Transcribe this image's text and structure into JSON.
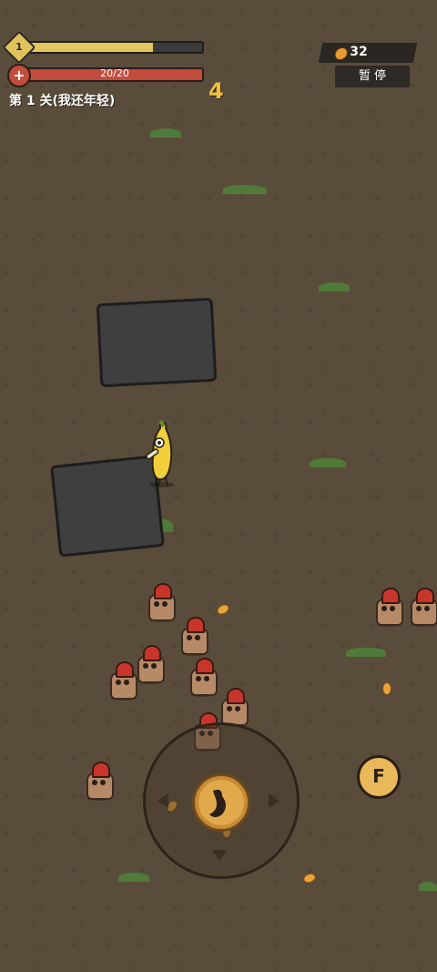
{
  "hud": {
    "level": "1",
    "xp_fraction": 0.72,
    "hp_text": "20/20",
    "hp_fraction": 1.0,
    "stage_label": "第 1 关(我还年轻)",
    "kill_count": "4",
    "coins": "32",
    "pause_label": "暂 停"
  },
  "controls": {
    "action_button_label": "F"
  },
  "colors": {
    "xp": "#e5c55d",
    "hp": "#c24d3c",
    "kill_count": "#f0c23b"
  }
}
